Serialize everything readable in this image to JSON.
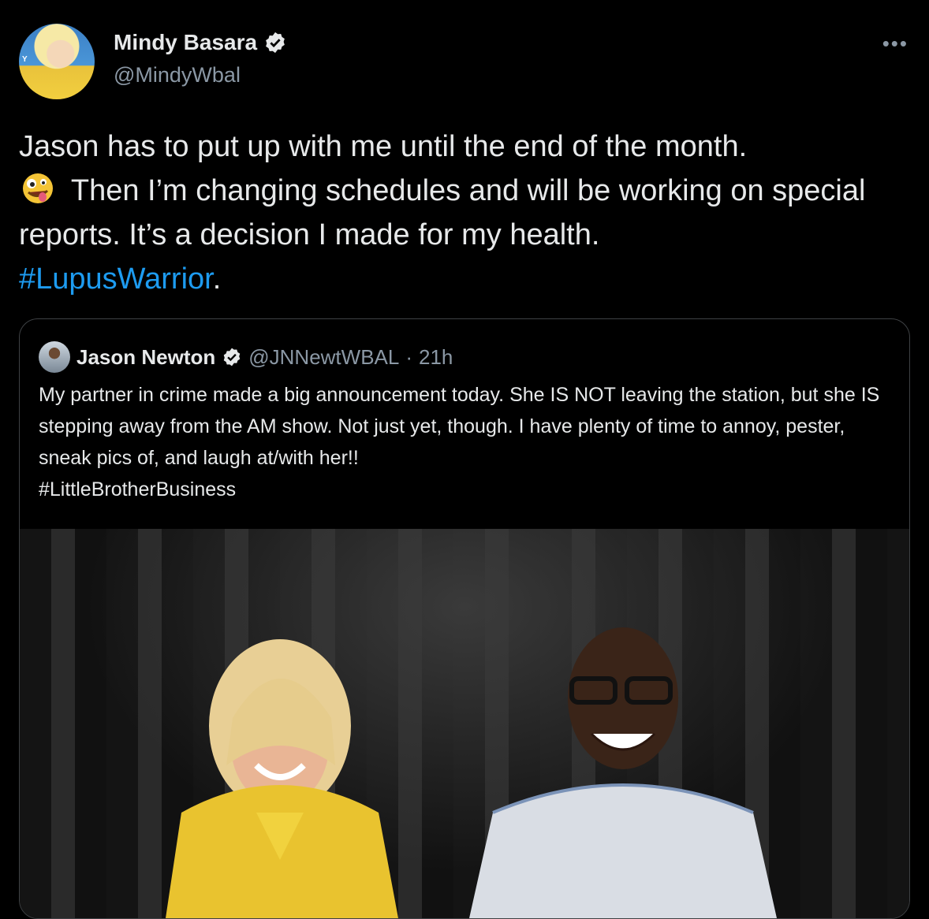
{
  "author": {
    "name": "Mindy Basara",
    "handle": "@MindyWbal",
    "verified": true,
    "avatar_tag": "Y"
  },
  "more_icon": "more-horizontal-icon",
  "tweet": {
    "line1": "Jason has to put up with me until the end of the month.",
    "emoji": "zany-face",
    "line2": " Then I’m changing schedules and will be working on special reports. It’s a decision I made for my health.",
    "hashtag": "#LupusWarrior",
    "trail": "."
  },
  "quoted_tweet": {
    "name": "Jason Newton",
    "handle": "@JNNewtWBAL",
    "separator": "·",
    "time": "21h",
    "verified": true,
    "text": "My partner in crime made a big announcement today. She IS NOT leaving the station, but she IS stepping away from the AM show. Not just yet, though. I have plenty of time to annoy, pester, sneak pics of, and laugh at/with her!!",
    "hashtag": "#LittleBrotherBusiness"
  },
  "colors": {
    "background": "#000000",
    "text": "#e7e9ea",
    "secondary": "#8b98a5",
    "link": "#1d9bf0",
    "verified": "#e7e9ea"
  }
}
